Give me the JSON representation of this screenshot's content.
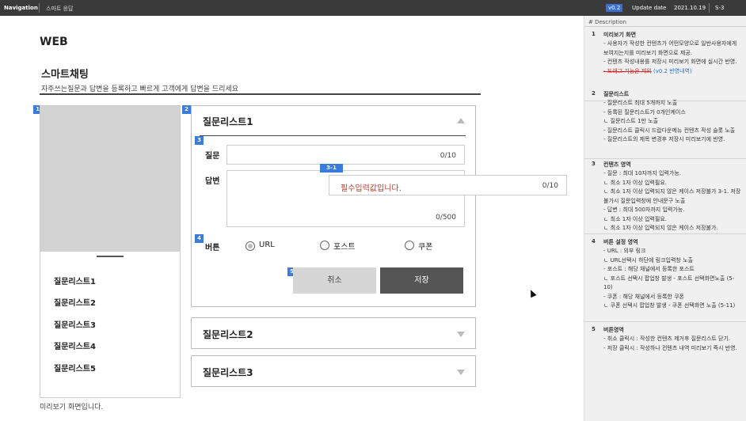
{
  "topbar": {
    "nav": "Navigation",
    "breadcrumb": "스마트 응답",
    "version": "v0.2",
    "update_label": "Update date",
    "update_date": "2021.10.19",
    "screen_code": "S-3"
  },
  "page": {
    "platform": "WEB",
    "title": "스마트채팅",
    "subtitle": "자주쓰는질문과 답변을 등록하고 빠르게 고객에게 답변을 드리세요"
  },
  "preview": {
    "badge": "1",
    "list": [
      "질문리스트1",
      "질문리스트2",
      "질문리스트3",
      "질문리스트4",
      "질문리스트5"
    ],
    "caption": "미리보기 화면입니다."
  },
  "editor": {
    "badge_list": "2",
    "badge_form": "3",
    "badge_button": "4",
    "badge_actions": "5",
    "badge_tooltip": "3-1",
    "panels": [
      "질문리스트1",
      "질문리스트2",
      "질문리스트3"
    ],
    "question_label": "질문",
    "question_count": "0/10",
    "answer_label": "답변",
    "answer_count": "0/500",
    "button_label": "버튼",
    "button_types": [
      "URL",
      "포스트",
      "쿠폰"
    ],
    "selected_type": "URL",
    "cancel": "취소",
    "save": "저장",
    "tooltip_message": "필수입력값입니다.",
    "tooltip_count": "0/10"
  },
  "description": {
    "header": "# Description",
    "sections": [
      {
        "num": "1",
        "title": "미리보기 화면",
        "lines": [
          "- 사용자가 작성한 컨텐츠가 어떤모양으로 일반사용자에게 보여지는지를 미리보기 화면으로 제공.",
          "- 컨텐츠 작성내용를 저장시 미리보기 화면에 실시간 반영."
        ],
        "strike": "- 드래그 기능은 제외",
        "note": "(v0.2 반영내역)"
      },
      {
        "num": "2",
        "title": "질문리스트",
        "lines": [
          "- 질문리스트 최대 5개까지 노출",
          "- 등록된 질문리스트가 0개인케이스",
          "   ㄴ 질문리스트 1만 노출",
          "- 질문리스트 클릭시 드랍다운메뉴 컨텐츠 작성 슬롯 노출",
          "- 질문리스트의 제목 변경후 저장시 미리보기에 반영."
        ]
      },
      {
        "num": "3",
        "title": "컨텐츠 영역",
        "lines": [
          "- 질문 : 최대 10자까지 입력가능.",
          "   ㄴ 최소 1자 이상 입력필요.",
          "   ㄴ 최소 1자 이상 입력되지 않은 케이스 저장불가 3-1. 저장불가시 질문입력창에 안내문구 노출",
          "- 답변 : 최대 500자까지 입력가능.",
          "   ㄴ 최소 1자 이상 입력필요.",
          "   ㄴ 최소 1자 이상 입력되지 않은 케이스 저장불가."
        ]
      },
      {
        "num": "4",
        "title": "버튼 설정 영역",
        "lines": [
          "- URL : 외부 링크",
          "   ㄴ URL선택시 하단에 링크입력창 노출",
          "- 포스트 : 해당 채널에서 등록한 포스트",
          "   ㄴ 포스트 선택시 팝업창 발생 - 포스트 선택화면노출 (5-10)",
          "- 쿠폰 : 해당 채널에서 등록한 쿠폰",
          "   ㄴ 쿠폰 선택시 팝업창 발생 - 쿠폰 선택화면 노출 (5-11)"
        ]
      },
      {
        "num": "5",
        "title": "버튼영역",
        "lines": [
          "- 취소 클릭시 : 작성한 컨텐츠 제거후 질문리스트 닫기.",
          "- 저장 클릭시 : 작성하나 컨텐츠 내역 미리보기 즉시 반영."
        ]
      }
    ]
  }
}
